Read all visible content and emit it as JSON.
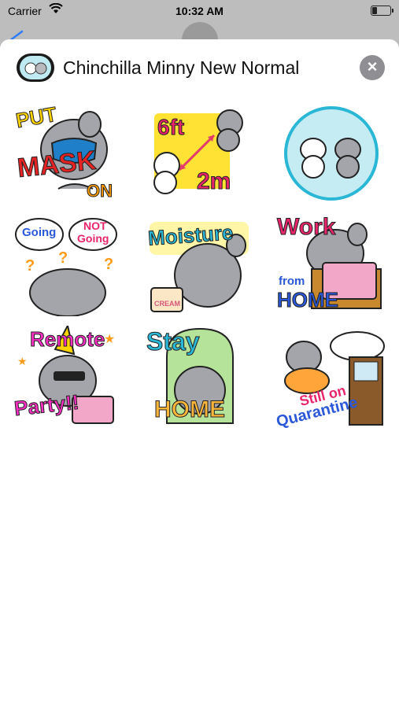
{
  "status_bar": {
    "carrier": "Carrier",
    "time": "10:32 AM",
    "battery_level": 0.25
  },
  "header": {
    "title": "Chinchilla Minny New Normal",
    "close_icon": "close-icon"
  },
  "colors": {
    "chinchilla": "#9fa1a6",
    "close_button": "#8e8e93"
  },
  "stickers": [
    {
      "name": "put-mask-on",
      "texts": [
        "PUT",
        "MASK",
        "ON"
      ]
    },
    {
      "name": "six-feet",
      "texts": [
        "6ft",
        "2m"
      ]
    },
    {
      "name": "two-chinchillas",
      "texts": []
    },
    {
      "name": "going-not-going",
      "texts": [
        "Going",
        "NOT",
        "Going"
      ]
    },
    {
      "name": "moisture",
      "texts": [
        "Moisture",
        "CREAM"
      ]
    },
    {
      "name": "work-from-home",
      "texts": [
        "Work",
        "from",
        "HOME"
      ]
    },
    {
      "name": "remote-party",
      "texts": [
        "Remote",
        "Party!!"
      ]
    },
    {
      "name": "stay-home",
      "texts": [
        "Stay",
        "HOME"
      ]
    },
    {
      "name": "still-on-quarantine",
      "texts": [
        "Still on",
        "Quarantine"
      ]
    }
  ]
}
